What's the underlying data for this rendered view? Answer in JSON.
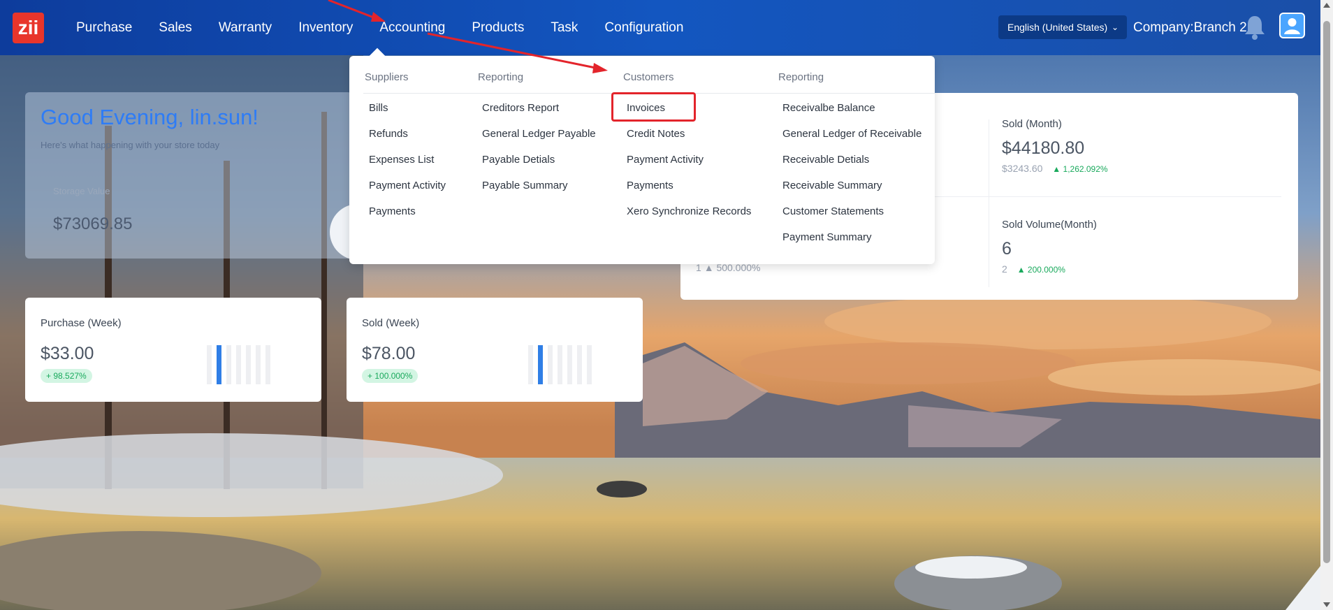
{
  "header": {
    "logo_text": "zii",
    "nav": [
      "Purchase",
      "Sales",
      "Warranty",
      "Inventory",
      "Accounting",
      "Products",
      "Task",
      "Configuration"
    ],
    "language": "English (United States)",
    "company": "Company:Branch 2"
  },
  "greeting": {
    "title": "Good Evening, lin.sun!",
    "subtitle": "Here's what happening with your store today",
    "storage_label": "Storage Value",
    "storage_value": "$73069.85"
  },
  "stats": {
    "sold_month": {
      "label": "Sold (Month)",
      "value": "$44180.80",
      "prev": "$3243.60",
      "pct": "1,262.092%"
    },
    "sold_volume": {
      "label": "Sold Volume(Month)",
      "value": "6",
      "prev": "2",
      "pct": "200.000%"
    },
    "purchase_volume_prev": {
      "value": "1",
      "pct": "500.000%"
    }
  },
  "week_cards": {
    "purchase": {
      "title": "Purchase (Week)",
      "value": "$33.00",
      "badge": "+ 98.527%",
      "bars": [
        0,
        1,
        0,
        0,
        0,
        0,
        0
      ]
    },
    "sold": {
      "title": "Sold (Week)",
      "value": "$78.00",
      "badge": "+ 100.000%",
      "bars": [
        0,
        1,
        0,
        0,
        0,
        0,
        0
      ]
    }
  },
  "accounting_menu": {
    "suppliers": {
      "head": "Suppliers",
      "items": [
        "Bills",
        "Refunds",
        "Expenses List",
        "Payment Activity",
        "Payments"
      ]
    },
    "suppliers_reporting": {
      "head": "Reporting",
      "items": [
        "Creditors Report",
        "General Ledger Payable",
        "Payable Detials",
        "Payable Summary"
      ]
    },
    "customers": {
      "head": "Customers",
      "items": [
        "Invoices",
        "Credit Notes",
        "Payment Activity",
        "Payments",
        "Xero Synchronize Records"
      ]
    },
    "customers_reporting": {
      "head": "Reporting",
      "items": [
        "Receivalbe Balance",
        "General Ledger of Receivable",
        "Receivable Detials",
        "Receivable Summary",
        "Customer Statements",
        "Payment Summary"
      ]
    }
  },
  "colors": {
    "header_blue": "#1356c0",
    "accent_blue": "#2e7cf6",
    "green": "#19a95c",
    "highlight_red": "#e3242b"
  },
  "icons": [
    "bell-icon",
    "avatar-icon",
    "chevron-down-icon"
  ]
}
